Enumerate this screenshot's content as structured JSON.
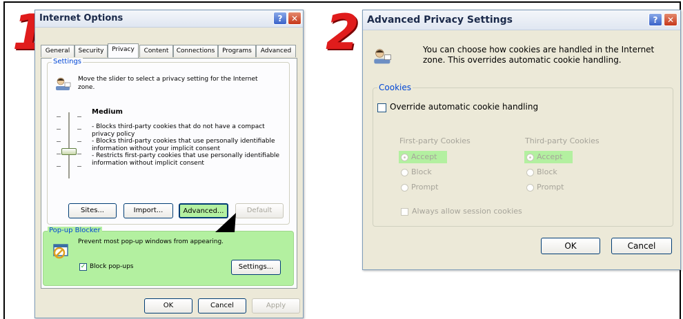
{
  "steps": {
    "one": "1",
    "two": "2"
  },
  "internet_options": {
    "title": "Internet Options",
    "help_glyph": "?",
    "close_glyph": "✕",
    "tabs": [
      "General",
      "Security",
      "Privacy",
      "Content",
      "Connections",
      "Programs",
      "Advanced"
    ],
    "active_tab": "Privacy",
    "settings": {
      "group_label": "Settings",
      "intro": [
        "Move the slider to select a privacy setting for the Internet",
        "zone."
      ],
      "level": "Medium",
      "description": [
        "- Blocks third-party cookies that do not have a compact",
        "privacy policy",
        "- Blocks third-party cookies that use personally identifiable",
        "information without your implicit consent",
        "- Restricts first-party cookies that use personally identifiable",
        "information without implicit consent"
      ],
      "buttons": {
        "sites": "Sites...",
        "import": "Import...",
        "advanced": "Advanced...",
        "default": "Default"
      }
    },
    "popup": {
      "group_label": "Pop-up Blocker",
      "text": "Prevent most pop-up windows from appearing.",
      "checkbox_label": "Block pop-ups",
      "checked": true,
      "settings_button": "Settings..."
    },
    "footer": {
      "ok": "OK",
      "cancel": "Cancel",
      "apply": "Apply"
    }
  },
  "advanced_privacy": {
    "title": "Advanced Privacy Settings",
    "help_glyph": "?",
    "close_glyph": "✕",
    "intro": [
      "You can choose how cookies are handled in the Internet",
      "zone.  This overrides automatic cookie handling."
    ],
    "cookies_label": "Cookies",
    "override_label": "Override automatic cookie handling",
    "override_checked": false,
    "first_party": {
      "label": "First-party Cookies",
      "options": [
        "Accept",
        "Block",
        "Prompt"
      ],
      "selected": "Accept"
    },
    "third_party": {
      "label": "Third-party Cookies",
      "options": [
        "Accept",
        "Block",
        "Prompt"
      ],
      "selected": "Accept"
    },
    "session_label": "Always allow session cookies",
    "footer": {
      "ok": "OK",
      "cancel": "Cancel"
    }
  },
  "colors": {
    "highlight": "#b3f0a0",
    "step_red": "#e01c1c",
    "arrow": "#000000"
  },
  "icons": [
    "privacy-person-icon",
    "popup-blocker-icon",
    "pointer-arrow-icon"
  ]
}
